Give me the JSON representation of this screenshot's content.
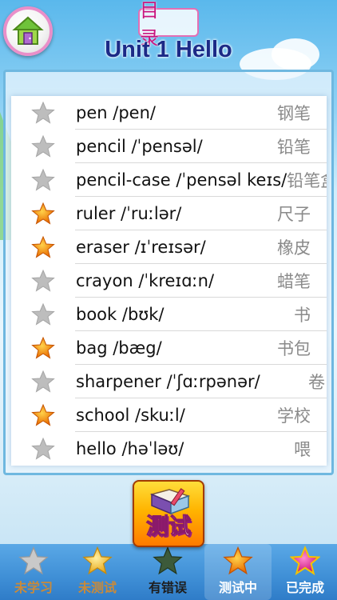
{
  "header": {
    "title": "目 录",
    "unit_title": "Unit 1 Hello"
  },
  "words": [
    {
      "word": "pen",
      "phonetic": "/pen/",
      "chinese": "钢笔",
      "star": "gray"
    },
    {
      "word": "pencil",
      "phonetic": "/ˈpensəl/",
      "chinese": "铅笔",
      "star": "gray"
    },
    {
      "word": "pencil-case",
      "phonetic": "/ˈpensəl keɪs/",
      "chinese": "铅笔盒",
      "star": "gray"
    },
    {
      "word": "ruler",
      "phonetic": "/ˈruːlər/",
      "chinese": "尺子",
      "star": "orange"
    },
    {
      "word": "eraser",
      "phonetic": "/ɪˈreɪsər/",
      "chinese": "橡皮",
      "star": "orange"
    },
    {
      "word": "crayon",
      "phonetic": "/ˈkreɪɑːn/",
      "chinese": "蜡笔",
      "star": "gray"
    },
    {
      "word": "book",
      "phonetic": "/bʊk/",
      "chinese": "书",
      "star": "gray"
    },
    {
      "word": "bag",
      "phonetic": "/bæg/",
      "chinese": "书包",
      "star": "orange"
    },
    {
      "word": "sharpener",
      "phonetic": "/ˈʃɑːrpənər/",
      "chinese": "卷",
      "star": "gray"
    },
    {
      "word": "school",
      "phonetic": "/skuːl/",
      "chinese": "学校",
      "star": "orange"
    },
    {
      "word": "hello",
      "phonetic": "/həˈləʊ/",
      "chinese": "喂",
      "star": "gray"
    }
  ],
  "test_button": {
    "label": "测试"
  },
  "filters": [
    {
      "label": "未学习",
      "star": "gray",
      "label_color": "#c98a3a"
    },
    {
      "label": "未测试",
      "star": "yellow",
      "label_color": "#c98a3a"
    },
    {
      "label": "有错误",
      "star": "darkgreen",
      "label_color": "#1e1e1e"
    },
    {
      "label": "测试中",
      "star": "orange",
      "label_color": "#ffffff"
    },
    {
      "label": "已完成",
      "star": "magenta",
      "label_color": "#ffffff"
    }
  ],
  "colors": {
    "gray_star": "#bdbdbd",
    "orange_star": "#f28a12",
    "yellow_star": "#f6c23a",
    "darkgreen_star": "#3c5a3a",
    "magenta_star": "#e0208f",
    "accent_title": "#c8157f",
    "unit_title": "#1c2a87"
  }
}
